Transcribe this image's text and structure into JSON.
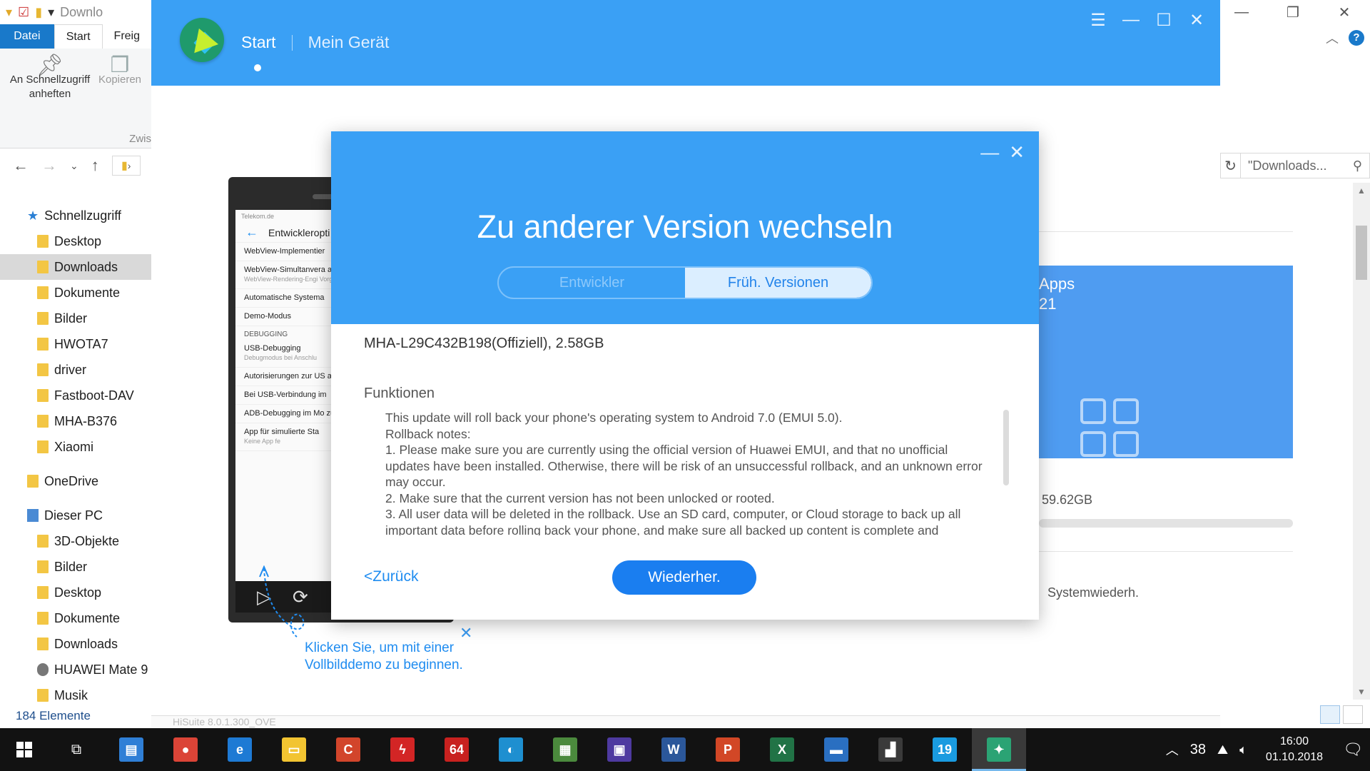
{
  "explorer": {
    "qat_title": "Downlo",
    "tabs": {
      "datei": "Datei",
      "start": "Start",
      "freig": "Freig"
    },
    "ribbon": {
      "pin": "An Schnellzugriff anheften",
      "copy": "Kopieren",
      "group": "Zwis"
    },
    "tree": [
      {
        "label": "Schnellzugriff",
        "icon": "star-icon",
        "level": 0
      },
      {
        "label": "Desktop",
        "icon": "folder-icon",
        "level": 1
      },
      {
        "label": "Downloads",
        "icon": "download-folder-icon",
        "level": 1,
        "selected": true
      },
      {
        "label": "Dokumente",
        "icon": "folder-icon",
        "level": 1
      },
      {
        "label": "Bilder",
        "icon": "folder-icon",
        "level": 1
      },
      {
        "label": "HWOTA7",
        "icon": "folder-icon",
        "level": 1
      },
      {
        "label": "driver",
        "icon": "folder-icon",
        "level": 1
      },
      {
        "label": "Fastboot-DAV",
        "icon": "folder-icon",
        "level": 1
      },
      {
        "label": "MHA-B376",
        "icon": "folder-icon",
        "level": 1
      },
      {
        "label": "Xiaomi",
        "icon": "folder-icon",
        "level": 1
      },
      {
        "label": "OneDrive",
        "icon": "folder-icon",
        "level": 0
      },
      {
        "label": "Dieser PC",
        "icon": "pc-icon",
        "level": 0
      },
      {
        "label": "3D-Objekte",
        "icon": "folder-icon",
        "level": 1
      },
      {
        "label": "Bilder",
        "icon": "folder-icon",
        "level": 1
      },
      {
        "label": "Desktop",
        "icon": "folder-icon",
        "level": 1
      },
      {
        "label": "Dokumente",
        "icon": "folder-icon",
        "level": 1
      },
      {
        "label": "Downloads",
        "icon": "download-folder-icon",
        "level": 1
      },
      {
        "label": "HUAWEI Mate 9",
        "icon": "drive-icon",
        "level": 1
      },
      {
        "label": "Musik",
        "icon": "folder-icon",
        "level": 1
      }
    ],
    "status": "184 Elemente",
    "search_text": "\"Downloads..."
  },
  "hisuite": {
    "nav": {
      "start": "Start",
      "device": "Mein Gerät"
    },
    "phone": {
      "status": "Telekom.de",
      "title": "Entwickleropti",
      "items": [
        {
          "title": "WebView-Implementier",
          "sub": ""
        },
        {
          "title": "WebView-Simultanvera aktivieren",
          "sub": "WebView-Rendering-Engi Vorgang ausführen"
        },
        {
          "title": "Automatische Systema",
          "sub": ""
        },
        {
          "title": "Demo-Modus",
          "sub": ""
        }
      ],
      "section": "DEBUGGING",
      "items2": [
        {
          "title": "USB-Debugging",
          "sub": "Debugmodus bei Anschlu"
        },
        {
          "title": "Autorisierungen zur US aufheben",
          "sub": ""
        },
        {
          "title": "Bei USB-Verbindung im",
          "sub": ""
        },
        {
          "title": "ADB-Debugging im Mo zulassen",
          "sub": ""
        },
        {
          "title": "App für simulierte Sta",
          "sub": "Keine App fe"
        }
      ]
    },
    "demo_hint": "Klicken Sie, um mit einer Vollbilddemo zu beginnen.",
    "apps_text": "Apps\n21",
    "storage_text": ": 59.62GB",
    "restore_link": "Systemwiederh.",
    "bottom_text": "HiSuite 8.0.1.300_OVE"
  },
  "dialog": {
    "title": "Zu anderer Version wechseln",
    "tab_dev": "Entwickler",
    "tab_old": "Früh. Versionen",
    "version": "MHA-L29C432B198(Offiziell), 2.58GB",
    "func_label": "Funktionen",
    "notes": "This update will roll back your phone's operating system to Android 7.0 (EMUI 5.0).\nRollback notes:\n1. Please make sure you are currently using the official version of Huawei EMUI, and that no unofficial updates have been installed. Otherwise, there will be risk of an unsuccessful rollback, and an unknown error may occur.\n2. Make sure that the current version has not been unlocked or rooted.\n3. All user data will be deleted in the rollback. Use an SD card, computer, or Cloud storage to back up all important data before rolling back your phone, and make sure all backed up content is complete and",
    "back": "<Zurück",
    "button": "Wiederher."
  },
  "taskbar": {
    "apps": [
      {
        "name": "control-panel-icon",
        "color": "#2f7fd6",
        "glyph": "▤"
      },
      {
        "name": "chrome-icon",
        "color": "#db4437",
        "glyph": "●"
      },
      {
        "name": "edge-icon",
        "color": "#1e7ad4",
        "glyph": "e"
      },
      {
        "name": "file-explorer-icon",
        "color": "#f2c431",
        "glyph": "▭"
      },
      {
        "name": "ccleaner-icon",
        "color": "#d2452b",
        "glyph": "C"
      },
      {
        "name": "flash-icon",
        "color": "#d32525",
        "glyph": "ϟ"
      },
      {
        "name": "aida64-icon",
        "color": "#c8211f",
        "glyph": "64"
      },
      {
        "name": "browser-icon",
        "color": "#1e8fd0",
        "glyph": "◐"
      },
      {
        "name": "gpu-icon",
        "color": "#4b8a3d",
        "glyph": "▦"
      },
      {
        "name": "cpu-icon",
        "color": "#4e3aa0",
        "glyph": "▣"
      },
      {
        "name": "word-icon",
        "color": "#2b579a",
        "glyph": "W"
      },
      {
        "name": "powerpoint-icon",
        "color": "#d24726",
        "glyph": "P"
      },
      {
        "name": "excel-icon",
        "color": "#217346",
        "glyph": "X"
      },
      {
        "name": "app-window-icon",
        "color": "#2a6fc1",
        "glyph": "▬"
      },
      {
        "name": "benchmark-icon",
        "color": "#3a3a3a",
        "glyph": "▟"
      },
      {
        "name": "calendar-19-icon",
        "color": "#1a9be0",
        "glyph": "19"
      },
      {
        "name": "hisuite-icon",
        "color": "#2ba374",
        "glyph": "✦",
        "active": true
      }
    ],
    "temp": "38",
    "time": "16:00",
    "date": "01.10.2018"
  }
}
